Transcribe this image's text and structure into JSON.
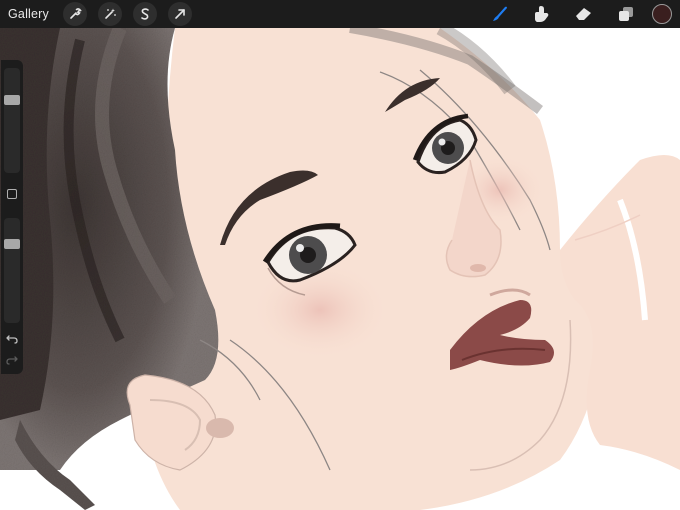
{
  "toolbar": {
    "gallery_label": "Gallery",
    "left_icons": [
      "wrench-icon",
      "magic-wand-icon",
      "selection-s-icon",
      "transform-arrow-icon"
    ],
    "right_icons": [
      "brush-icon",
      "smudge-icon",
      "eraser-icon",
      "layers-icon"
    ],
    "active_tool": "brush",
    "active_color": "#3a1f1f"
  },
  "sidebar": {
    "brush_size_level": 0.28,
    "opacity_level": 0.22,
    "icons": [
      "modify-square-icon",
      "undo-icon",
      "redo-icon"
    ]
  },
  "canvas": {
    "background": "#ffffff",
    "skin_color": "#f8e1d4",
    "hair_color": "#4a413f",
    "lip_color": "#8b4a48"
  }
}
